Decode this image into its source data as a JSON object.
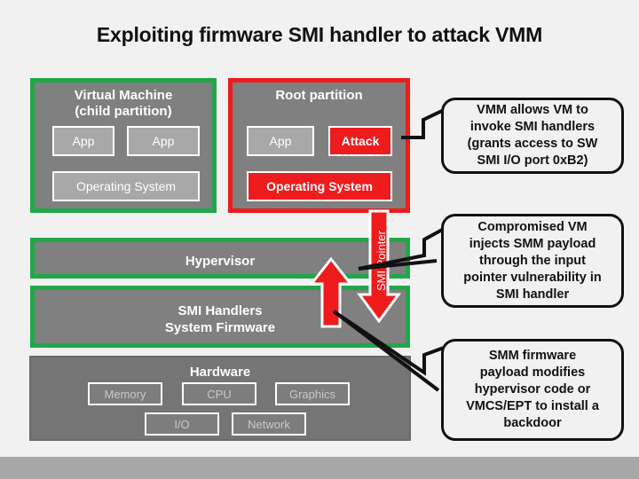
{
  "slide": {
    "title": "Exploiting firmware SMI handler to attack VMM",
    "background_color": "#f1f1f1",
    "accent_green": "#1fa74a",
    "accent_red": "#ee1c1c",
    "panel_gray": "#808080",
    "band_color": "#a7a7a7"
  },
  "vm_panel": {
    "title": "Virtual Machine\n(child partition)",
    "app_left": "App",
    "app_right": "App",
    "os": "Operating System"
  },
  "root_panel": {
    "title": "Root partition",
    "app": "App",
    "attack": "Attack",
    "os": "Operating System"
  },
  "hypervisor": {
    "label": "Hypervisor"
  },
  "firmware": {
    "label": "SMI Handlers\nSystem Firmware"
  },
  "hardware": {
    "title": "Hardware",
    "components": [
      "Memory",
      "CPU",
      "Graphics",
      "I/O",
      "Network"
    ]
  },
  "arrows": {
    "up_arrow_name": "smi-invoke-up-arrow",
    "down_arrow_name": "smi-pointer-down-arrow",
    "smi_pointer_label": "SMI Pointer"
  },
  "callouts": [
    {
      "id": "vmm-allows-callout",
      "text": "VMM allows VM to\ninvoke SMI handlers\n(grants access to SW\nSMI I/O port 0xB2)"
    },
    {
      "id": "compromised-vm-callout",
      "text": "Compromised VM\ninjects SMM payload\nthrough the input\npointer vulnerability in\nSMI handler"
    },
    {
      "id": "smm-firmware-callout",
      "text": "SMM firmware\npayload modifies\nhypervisor code or\nVMCS/EPT to install a\nbackdoor"
    }
  ]
}
